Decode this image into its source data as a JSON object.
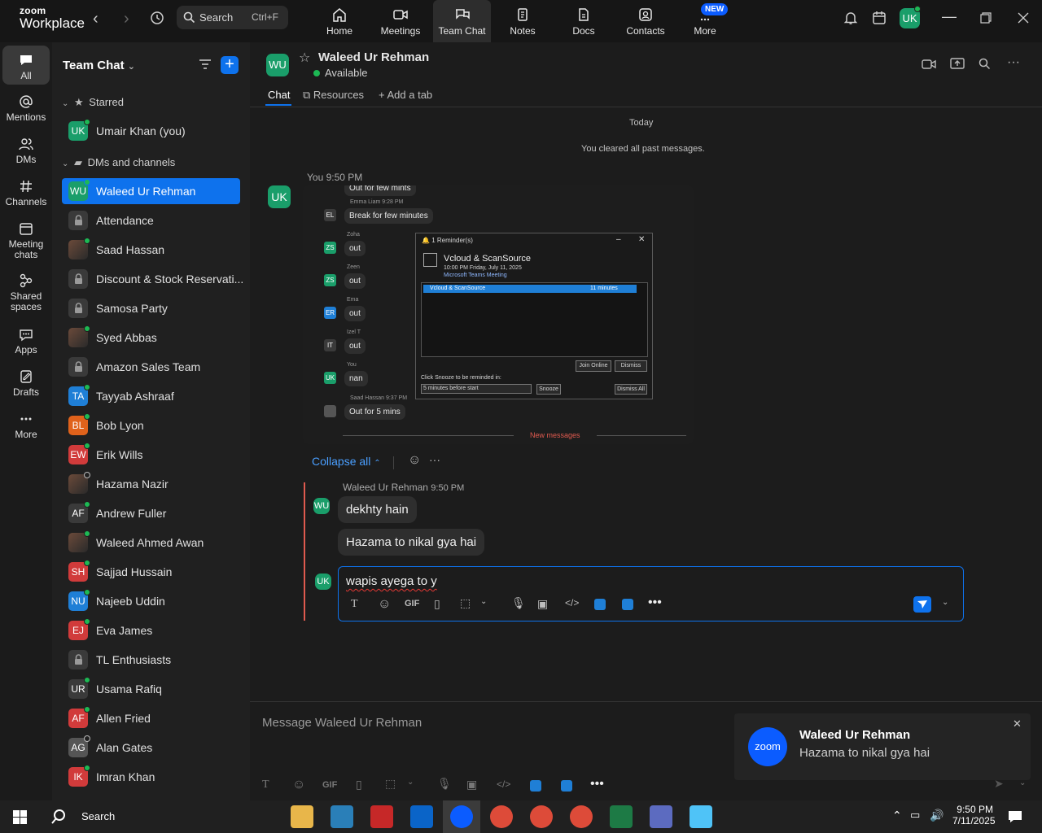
{
  "app": {
    "logo_line1": "zoom",
    "logo_line2": "Workplace",
    "search_label": "Search",
    "search_shortcut": "Ctrl+F",
    "new_badge": "NEW",
    "user_initials": "UK"
  },
  "top_tabs": [
    {
      "label": "Home",
      "icon": "home-icon"
    },
    {
      "label": "Meetings",
      "icon": "video-camera-icon"
    },
    {
      "label": "Team Chat",
      "icon": "chat-bubbles-icon"
    },
    {
      "label": "Notes",
      "icon": "notes-icon"
    },
    {
      "label": "Docs",
      "icon": "docs-icon"
    },
    {
      "label": "Contacts",
      "icon": "contacts-icon"
    },
    {
      "label": "More",
      "icon": "more-icon"
    }
  ],
  "rail": [
    {
      "label": "All",
      "icon": "chat-icon"
    },
    {
      "label": "Mentions",
      "icon": "at-icon"
    },
    {
      "label": "DMs",
      "icon": "people-icon"
    },
    {
      "label": "Channels",
      "icon": "hash-icon"
    },
    {
      "label": "Meeting\nchats",
      "label1": "Meeting",
      "label2": "chats",
      "icon": "calendar-icon"
    },
    {
      "label1": "Shared",
      "label2": "spaces",
      "icon": "shared-spaces-icon"
    },
    {
      "label": "Apps",
      "icon": "apps-icon"
    },
    {
      "label": "Drafts",
      "icon": "drafts-icon"
    },
    {
      "label": "More",
      "icon": "more-dots-icon"
    }
  ],
  "sidebar": {
    "title": "Team Chat",
    "starred_label": "Starred",
    "dms_label": "DMs and channels",
    "starred": [
      {
        "initials": "UK",
        "name": "Umair Khan (you)",
        "color": "#1a9e6a",
        "online": true
      }
    ],
    "items": [
      {
        "initials": "WU",
        "name": "Waleed Ur Rehman",
        "color": "#1a9e6a",
        "online": true,
        "active": true
      },
      {
        "initials": "",
        "name": "Attendance",
        "lock": true
      },
      {
        "initials": "",
        "name": "Saad Hassan",
        "photo": true,
        "online": true
      },
      {
        "initials": "",
        "name": "Discount & Stock Reservati...",
        "lock": true
      },
      {
        "initials": "",
        "name": "Samosa Party",
        "lock": true
      },
      {
        "initials": "",
        "name": "Syed Abbas",
        "photo": true,
        "online": true
      },
      {
        "initials": "",
        "name": "Amazon Sales Team",
        "lock": true
      },
      {
        "initials": "TA",
        "name": "Tayyab Ashraaf",
        "color": "#1f7fd6",
        "online": true
      },
      {
        "initials": "BL",
        "name": "Bob Lyon",
        "color": "#e0621b",
        "online": true
      },
      {
        "initials": "EW",
        "name": "Erik Wills",
        "color": "#d13b3b",
        "online": true
      },
      {
        "initials": "",
        "name": "Hazama Nazir",
        "photo": true,
        "online": false
      },
      {
        "initials": "AF",
        "name": "Andrew Fuller",
        "color": "#3a3a3a",
        "online": true
      },
      {
        "initials": "",
        "name": "Waleed Ahmed Awan",
        "photo": true,
        "online": true
      },
      {
        "initials": "SH",
        "name": "Sajjad Hussain",
        "color": "#d13b3b",
        "online": true
      },
      {
        "initials": "NU",
        "name": "Najeeb Uddin",
        "color": "#1f7fd6",
        "online": true
      },
      {
        "initials": "EJ",
        "name": "Eva James",
        "color": "#d13b3b",
        "online": true
      },
      {
        "initials": "",
        "name": "TL Enthusiasts",
        "lock": true
      },
      {
        "initials": "UR",
        "name": "Usama Rafiq",
        "color": "#3a3a3a",
        "online": true
      },
      {
        "initials": "AF",
        "name": "Allen Fried",
        "color": "#d13b3b",
        "online": true
      },
      {
        "initials": "AG",
        "name": "Alan Gates",
        "color": "#555555",
        "online": false
      },
      {
        "initials": "IK",
        "name": "Imran Khan",
        "color": "#d13b3b",
        "online": true
      }
    ]
  },
  "chat": {
    "contact_initials": "WU",
    "contact_name": "Waleed Ur Rehman",
    "contact_status": "Available",
    "tabs": {
      "chat": "Chat",
      "resources": "Resources",
      "add": "Add a tab"
    },
    "day_label": "Today",
    "cleared_label": "You cleared all past messages.",
    "my_initials": "UK",
    "my_msg_header": "You 9:50 PM",
    "collapse_label": "Collapse all",
    "reply_sender": "Waleed Ur Rehman",
    "reply_time": "9:50 PM",
    "reply_1": "dekhty hain",
    "reply_2": "Hazama to nikal gya hai",
    "composer_text": "wapis ayega to y",
    "bottom_placeholder": "Message Waleed Ur Rehman"
  },
  "screenshot": {
    "line1": "Out for few mints",
    "sender1": "Emma Liam 9:28 PM",
    "msg1": "Break for few minutes",
    "msg_last_sender": "Saad Hassan 9:37 PM",
    "msg_last": "Out for 5 mins",
    "new_messages": "New messages",
    "partials": [
      "Zoha",
      "out",
      "Zeen",
      "out",
      "Ema",
      "out",
      "Izel T",
      "out",
      "You",
      "nan"
    ],
    "avatars": [
      "EL",
      "ZS",
      "ZS",
      "ER",
      "IT",
      "UK"
    ],
    "reminder": {
      "title": "1 Reminder(s)",
      "event": "Vcloud & ScanSource",
      "time": "10:00 PM Friday, July 11, 2025",
      "location": "Microsoft Teams Meeting",
      "row_name": "Vcloud & ScanSource",
      "row_due": "11 minutes",
      "join": "Join Online",
      "dismiss": "Dismiss",
      "snooze_hint": "Click Snooze to be reminded in:",
      "snooze_option": "5 minutes before start",
      "snooze": "Snooze",
      "dismiss_all": "Dismiss All"
    }
  },
  "toast": {
    "logo": "zoom",
    "title": "Waleed Ur Rehman",
    "body": "Hazama to nikal gya hai"
  },
  "taskbar": {
    "search": "Search",
    "time": "9:50 PM",
    "date": "7/11/2025"
  },
  "colors": {
    "accent": "#0e72ed",
    "online": "#1db954",
    "green_avatar": "#1a9e6a"
  }
}
